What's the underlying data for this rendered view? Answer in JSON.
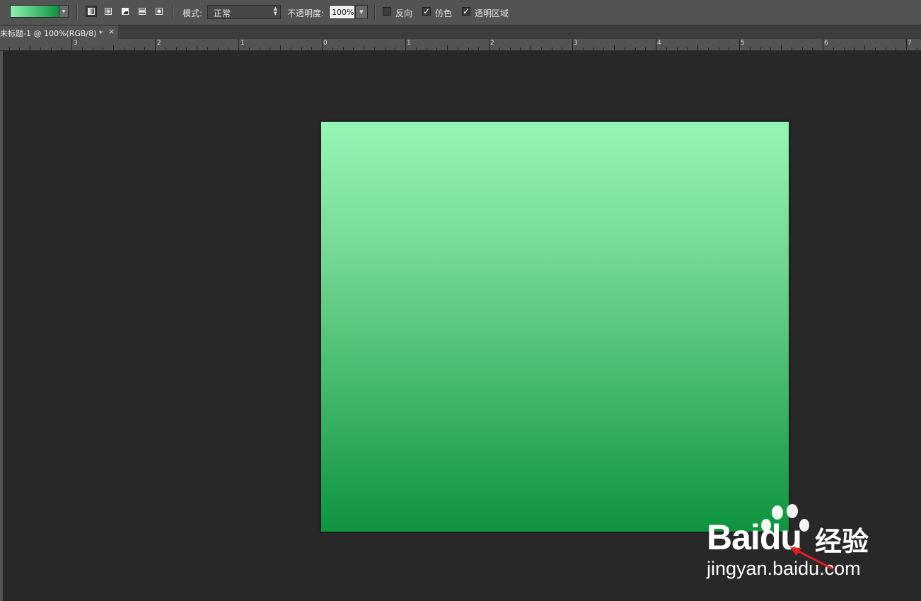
{
  "options_bar": {
    "gradient_preset": {
      "from_color": "#8ff0b0",
      "to_color": "#0e9440"
    },
    "gradient_types": [
      {
        "name": "linear-gradient",
        "active": true
      },
      {
        "name": "radial-gradient",
        "active": false
      },
      {
        "name": "angle-gradient",
        "active": false
      },
      {
        "name": "reflected-gradient",
        "active": false
      },
      {
        "name": "diamond-gradient",
        "active": false
      }
    ],
    "mode_label": "模式:",
    "mode_value": "正常",
    "opacity_label": "不透明度:",
    "opacity_value": "100%",
    "reverse_label": "反向",
    "reverse_checked": false,
    "dither_label": "仿色",
    "dither_checked": true,
    "transparency_label": "透明区域",
    "transparency_checked": true,
    "check_glyph": "✓"
  },
  "document_tab": {
    "title": "未标题-1 @ 100%(RGB/8) *",
    "close_glyph": "×"
  },
  "ruler": {
    "labels": [
      "3",
      "2",
      "1",
      "0",
      "1",
      "2",
      "3",
      "4",
      "5",
      "6",
      "7"
    ]
  },
  "canvas": {
    "gradient_top": "#95f5b5",
    "gradient_bottom": "#0e943f"
  },
  "watermark": {
    "brand": "Bai",
    "brand_suffix": "du",
    "product": "经验",
    "url": "jingyan.baidu.com"
  }
}
